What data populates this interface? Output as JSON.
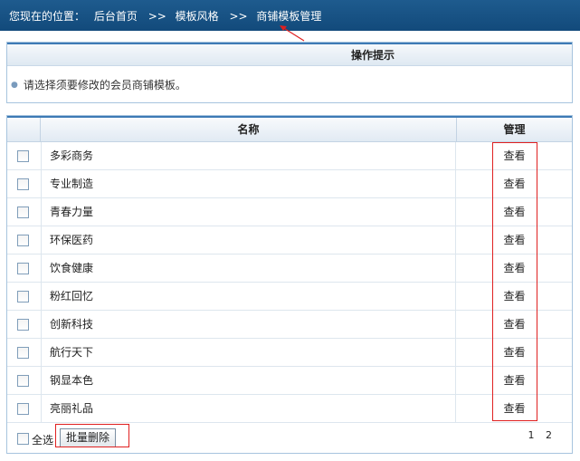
{
  "breadcrumb": {
    "prefix": "您现在的位置：",
    "items": [
      "后台首页",
      "模板风格",
      "商铺模板管理"
    ],
    "separator": ">>"
  },
  "tips": {
    "title": "操作提示",
    "text": "请选择须要修改的会员商铺模板。"
  },
  "table": {
    "columns": [
      "名称",
      "管理"
    ],
    "rows": [
      {
        "name": "多彩商务",
        "action": "查看"
      },
      {
        "name": "专业制造",
        "action": "查看"
      },
      {
        "name": "青春力量",
        "action": "查看"
      },
      {
        "name": "环保医药",
        "action": "查看"
      },
      {
        "name": "饮食健康",
        "action": "查看"
      },
      {
        "name": "粉红回忆",
        "action": "查看"
      },
      {
        "name": "创新科技",
        "action": "查看"
      },
      {
        "name": "航行天下",
        "action": "查看"
      },
      {
        "name": "钢显本色",
        "action": "查看"
      },
      {
        "name": "亮丽礼品",
        "action": "查看"
      }
    ]
  },
  "footer": {
    "select_all_label": "全选",
    "batch_delete_label": "批量删除",
    "pages": [
      "1",
      "2"
    ]
  },
  "colors": {
    "header_bar": "#1e5b8e",
    "accent_border": "#3d7ab5",
    "annotation": "#e02020"
  }
}
